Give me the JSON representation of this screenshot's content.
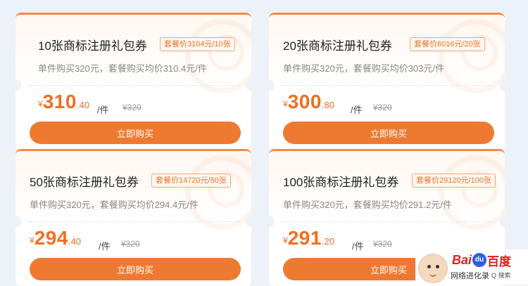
{
  "cards": [
    {
      "title": "10张商标注册礼包券",
      "tag": "套餐价3104元/10张",
      "desc": "单件购买320元，套餐购买均价310.4元/件",
      "currency": "¥",
      "price_int": "310",
      "price_dec": ".40",
      "unit": "/件",
      "orig": "¥320",
      "button": "立即购买"
    },
    {
      "title": "20张商标注册礼包券",
      "tag": "套餐价6016元/20张",
      "desc": "单件购买320元，套餐购买均价303元/件",
      "currency": "¥",
      "price_int": "300",
      "price_dec": ".80",
      "unit": "/件",
      "orig": "¥320",
      "button": "立即购买"
    },
    {
      "title": "50张商标注册礼包券",
      "tag": "套餐价14720元/50张",
      "desc": "单件购买320元，套餐购买均价294.4元/件",
      "currency": "¥",
      "price_int": "294",
      "price_dec": ".40",
      "unit": "/件",
      "orig": "¥320",
      "button": "立即购买"
    },
    {
      "title": "100张商标注册礼包券",
      "tag": "套餐价29120元/100张",
      "desc": "单件购买320元，套餐购买均价291.2元/件",
      "currency": "¥",
      "price_int": "291",
      "price_dec": ".20",
      "unit": "/件",
      "orig": "¥320",
      "button": "立即购买"
    }
  ],
  "watermark": {
    "brand_left": "Bai",
    "paw": "du",
    "brand_right": "百度",
    "subtitle": "网络进化录",
    "search": "Q 搜索"
  },
  "colors": {
    "accent": "#ee7a32",
    "price": "#ef6f22",
    "background": "#edf2f8"
  }
}
